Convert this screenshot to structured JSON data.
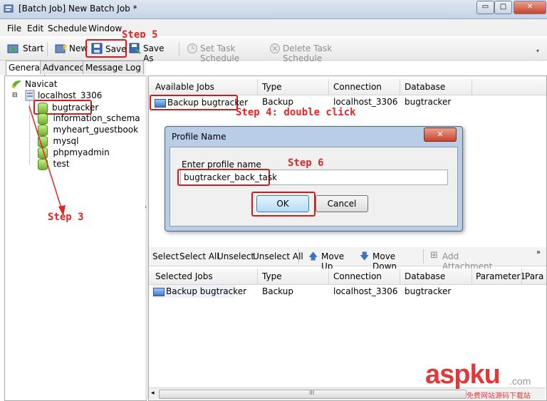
{
  "window": {
    "title": "[Batch Job] New Batch Job *",
    "controls": {
      "minimize": "▭",
      "maximize": "□",
      "close": "✕"
    }
  },
  "menu": [
    "File",
    "Edit",
    "Schedule",
    "Window"
  ],
  "toolbar": {
    "start": "Start",
    "new": "New",
    "save": "Save",
    "save_as": "Save As",
    "set_task_schedule": "Set Task Schedule",
    "delete_task_schedule": "Delete Task Schedule"
  },
  "tabs": [
    "General",
    "Advanced",
    "Message Log"
  ],
  "tree": {
    "root": "Navicat",
    "connection": "localhost_3306",
    "databases": [
      "bugtracker",
      "information_schema",
      "myheart_guestbook",
      "mysql",
      "phpmyadmin",
      "test"
    ]
  },
  "available_jobs": {
    "headers": [
      "Available Jobs",
      "Type",
      "Connection",
      "Database"
    ],
    "row": {
      "name": "Backup bugtracker",
      "type": "Backup",
      "connection": "localhost_3306",
      "database": "bugtracker"
    }
  },
  "dialog": {
    "title": "Profile Name",
    "label": "Enter profile name",
    "value": "bugtracker_back_task",
    "ok": "OK",
    "cancel": "Cancel",
    "close": "✕"
  },
  "batch_toolbar": {
    "select": "Select",
    "select_all": "Select All",
    "unselect": "Unselect",
    "unselect_all": "Unselect All",
    "move_up": "Move Up",
    "move_down": "Move Down",
    "add_attachment": "Add Attachment"
  },
  "selected_jobs": {
    "headers": [
      "Selected Jobs",
      "Type",
      "Connection",
      "Database",
      "Parameter1",
      "Para"
    ],
    "row": {
      "name": "Backup bugtracker",
      "type": "Backup",
      "connection": "localhost_3306",
      "database": "bugtracker"
    }
  },
  "annotations": {
    "step3": "Step 3",
    "step4": "Step 4: double click",
    "step5": "Step 5",
    "step6": "Step 6"
  },
  "scroll": {
    "grip": "III"
  },
  "watermark": {
    "brand": "aspku",
    "tld": ".com",
    "tagline": "免费网站源码下载站"
  },
  "colors": {
    "annotation_red": "#e12424",
    "title_bar": "#c4d3e6"
  }
}
